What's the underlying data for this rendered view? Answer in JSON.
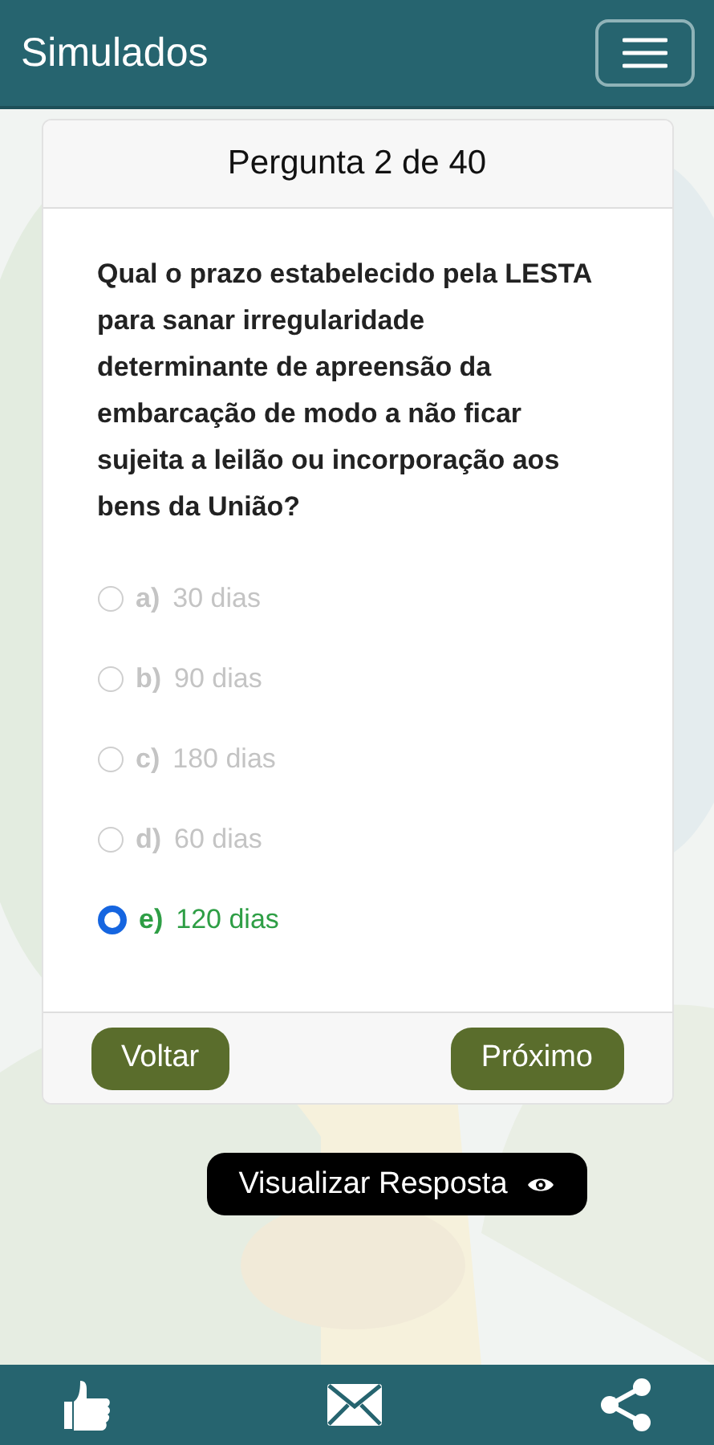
{
  "header": {
    "title": "Simulados"
  },
  "question": {
    "counter": "Pergunta 2 de 40",
    "text": "Qual o prazo estabelecido pela LESTA para sanar irregularidade determinante de apreensão da embarcação de modo a não ficar sujeita a leilão ou incorporação aos bens da União?",
    "options": [
      {
        "letter": "a)",
        "text": "30 dias",
        "selected": false
      },
      {
        "letter": "b)",
        "text": "90 dias",
        "selected": false
      },
      {
        "letter": "c)",
        "text": "180 dias",
        "selected": false
      },
      {
        "letter": "d)",
        "text": "60 dias",
        "selected": false
      },
      {
        "letter": "e)",
        "text": "120 dias",
        "selected": true
      }
    ]
  },
  "buttons": {
    "back": "Voltar",
    "next": "Próximo"
  },
  "reveal_button": "Visualizar Resposta"
}
